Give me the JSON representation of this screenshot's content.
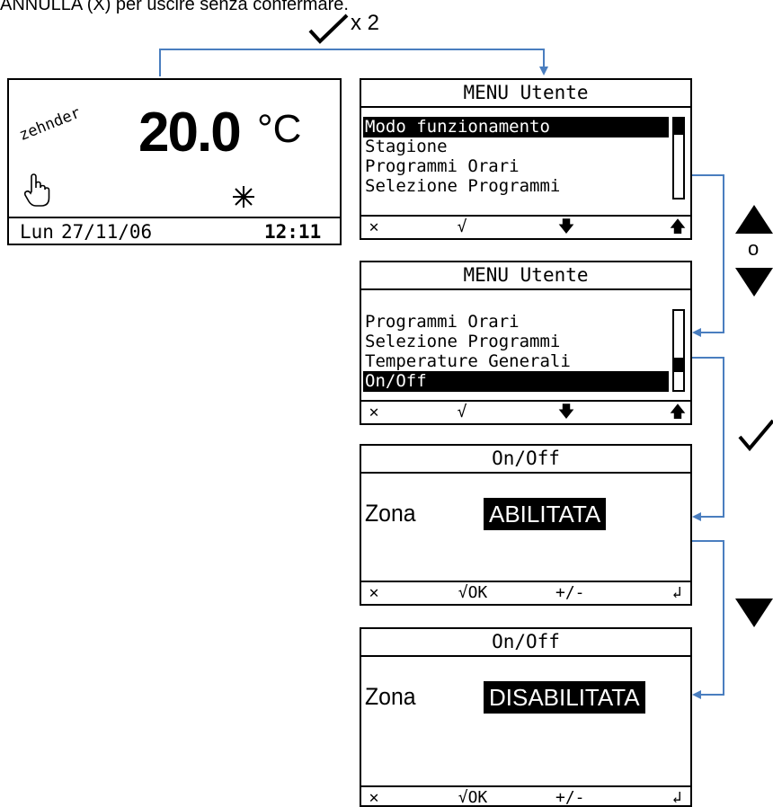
{
  "caption": "ANNULLA (X) per uscire senza confermare.",
  "top_action": {
    "times_label": "x 2"
  },
  "home_screen": {
    "brand": "zehnder",
    "temperature": "20.0",
    "unit": "°C",
    "day": "Lun",
    "date": "27/11/06",
    "time": "12:11"
  },
  "menu_screen_1": {
    "title": "MENU Utente",
    "items": [
      "Modo funzionamento",
      "Stagione",
      "Programmi Orari",
      "Selezione Programmi"
    ],
    "selected_index": 0
  },
  "menu_screen_2": {
    "title": "MENU Utente",
    "items": [
      "Programmi Orari",
      "Selezione Programmi",
      "Temperature Generali",
      "On/Off"
    ],
    "selected_index": 3
  },
  "onoff_screen_1": {
    "title": "On/Off",
    "zone_label": "Zona",
    "zone_value": "ABILITATA"
  },
  "onoff_screen_2": {
    "title": "On/Off",
    "zone_label": "Zona",
    "zone_value": "DISABILITATA"
  },
  "softkeys_menu": {
    "ok": "√"
  },
  "softkeys_edit": {
    "ok": "√OK",
    "plusminus": "+/-"
  },
  "side_keys": {
    "or_label": "o"
  },
  "colors": {
    "connector": "#4a7ebf",
    "lcd_ink": "#000000"
  }
}
